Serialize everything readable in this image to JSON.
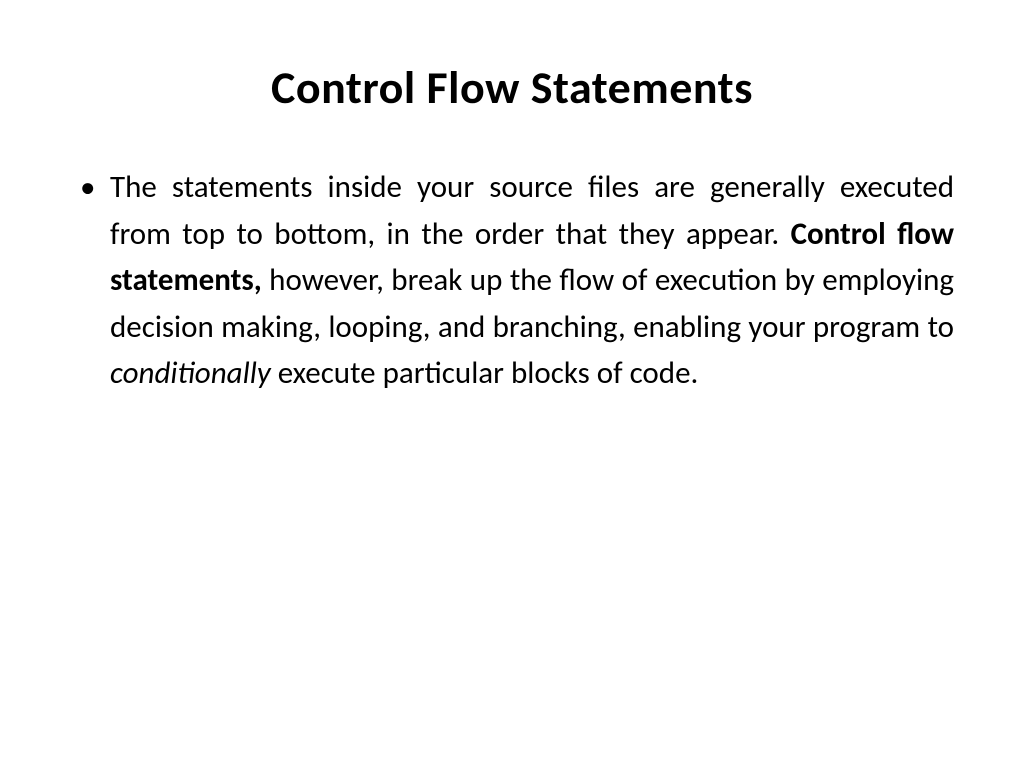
{
  "slide": {
    "title": "Control Flow Statements",
    "bullet": {
      "segment1": "The statements inside your source files are generally executed from top to bottom, in the order that they appear. ",
      "bold_segment": "Control flow statements,",
      "segment2": " however, break up the flow of execution by employing decision making, looping, and branching, enabling your program to ",
      "italic_segment": "conditionally",
      "segment3": " execute particular blocks of code."
    }
  }
}
